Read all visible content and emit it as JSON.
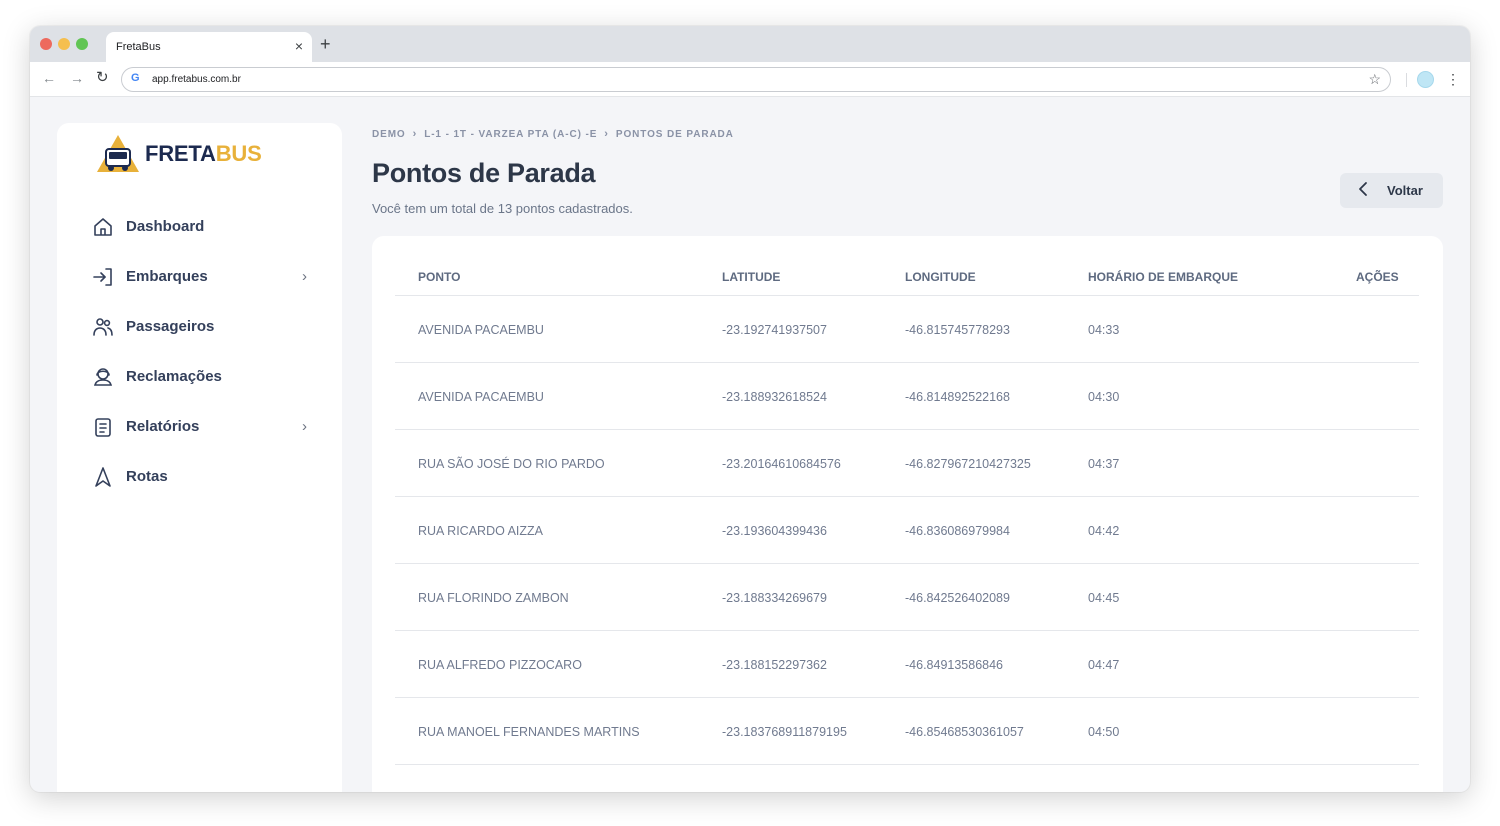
{
  "browser": {
    "tab_title": "FretaBus",
    "tab_close": "×",
    "new_tab": "+",
    "url": "app.fretabus.com.br"
  },
  "logo": {
    "part1": "FRETA",
    "part2": "BUS"
  },
  "sidebar": {
    "items": [
      {
        "label": "Dashboard",
        "icon": "home-icon",
        "has_submenu": false
      },
      {
        "label": "Embarques",
        "icon": "sign-in-icon",
        "has_submenu": true
      },
      {
        "label": "Passageiros",
        "icon": "users-icon",
        "has_submenu": false
      },
      {
        "label": "Reclamações",
        "icon": "support-agent-icon",
        "has_submenu": false
      },
      {
        "label": "Relatórios",
        "icon": "document-icon",
        "has_submenu": true
      },
      {
        "label": "Rotas",
        "icon": "navigation-icon",
        "has_submenu": false
      }
    ]
  },
  "breadcrumb": [
    "DEMO",
    "L-1 - 1T - VARZEA PTA (A-C) -E",
    "PONTOS DE PARADA"
  ],
  "page": {
    "title": "Pontos de Parada",
    "subtitle": "Você tem um total de 13 pontos cadastrados.",
    "back_label": "Voltar"
  },
  "table": {
    "headers": {
      "ponto": "PONTO",
      "latitude": "LATITUDE",
      "longitude": "LONGITUDE",
      "horario": "HORÁRIO DE EMBARQUE",
      "acoes": "AÇÕES"
    },
    "rows": [
      {
        "ponto": "AVENIDA PACAEMBU",
        "latitude": "-23.192741937507",
        "longitude": "-46.815745778293",
        "horario": "04:33"
      },
      {
        "ponto": "AVENIDA PACAEMBU",
        "latitude": "-23.188932618524",
        "longitude": "-46.814892522168",
        "horario": "04:30"
      },
      {
        "ponto": "RUA SÃO JOSÉ DO RIO PARDO",
        "latitude": "-23.20164610684576",
        "longitude": "-46.827967210427325",
        "horario": "04:37"
      },
      {
        "ponto": "RUA RICARDO AIZZA",
        "latitude": "-23.193604399436",
        "longitude": "-46.836086979984",
        "horario": "04:42"
      },
      {
        "ponto": "RUA FLORINDO ZAMBON",
        "latitude": "-23.188334269679",
        "longitude": "-46.842526402089",
        "horario": "04:45"
      },
      {
        "ponto": "RUA ALFREDO PIZZOCARO",
        "latitude": "-23.188152297362",
        "longitude": "-46.84913586846",
        "horario": "04:47"
      },
      {
        "ponto": "RUA MANOEL FERNANDES MARTINS",
        "latitude": "-23.183768911879195",
        "longitude": "-46.85468530361057",
        "horario": "04:50"
      }
    ]
  },
  "colors": {
    "brand_navy": "#1c2a4f",
    "brand_yellow": "#e8b13a",
    "page_background": "#f4f5f8",
    "text_muted": "#707a8f"
  }
}
